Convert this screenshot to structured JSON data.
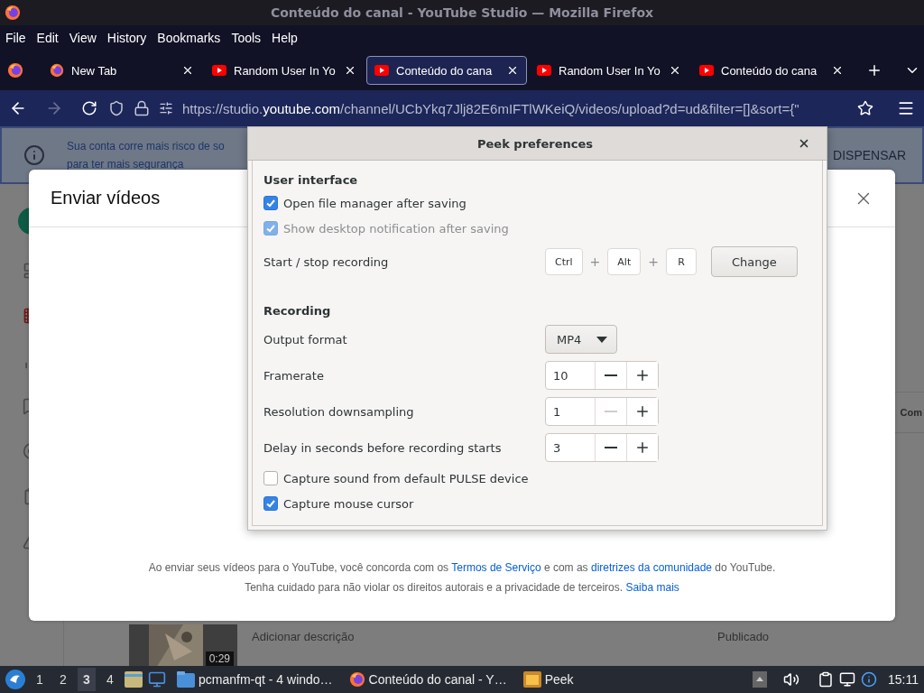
{
  "window": {
    "title": "Conteúdo do canal - YouTube Studio — Mozilla Firefox"
  },
  "menu": [
    "File",
    "Edit",
    "View",
    "History",
    "Bookmarks",
    "Tools",
    "Help"
  ],
  "tabs": [
    {
      "label": "New Tab",
      "kind": "firefox",
      "selected": false
    },
    {
      "label": "Random User In Yo",
      "kind": "youtube",
      "selected": false
    },
    {
      "label": "Conteúdo do cana",
      "kind": "youtube",
      "selected": true
    },
    {
      "label": "Random User In Yo",
      "kind": "youtube",
      "selected": false
    },
    {
      "label": "Conteúdo do cana",
      "kind": "youtube",
      "selected": false
    }
  ],
  "address_bar": {
    "prefix": "https://studio.",
    "domain": "youtube.com",
    "rest": "/channel/UCbYkq7Jlj82E6mIFTlWKeiQ/videos/upload?d=ud&filter=[]&sort={\""
  },
  "page": {
    "banner": {
      "lines": [
        "Sua conta corre mais risco de so",
        "para ter mais segurança"
      ],
      "action": "DISPENSAR"
    },
    "column_header": "Com",
    "video_row": {
      "duration": "0:29",
      "description": "Adicionar descrição",
      "visibility": "Publicado"
    }
  },
  "upload_dialog": {
    "title": "Enviar vídeos",
    "footer": [
      [
        {
          "text": "Ao enviar seus vídeos para o YouTube, você concorda com os ",
          "link": false
        },
        {
          "text": "Termos de Serviço",
          "link": true
        },
        {
          "text": " e com as ",
          "link": false
        },
        {
          "text": "diretrizes da comunidade",
          "link": true
        },
        {
          "text": " do YouTube.",
          "link": false
        }
      ],
      [
        {
          "text": "Tenha cuidado para não violar os direitos autorais e a privacidade de terceiros. ",
          "link": false
        },
        {
          "text": "Saiba mais",
          "link": true
        }
      ]
    ]
  },
  "peek_dialog": {
    "title": "Peek preferences",
    "sections": [
      {
        "heading": "User interface",
        "rows": [
          {
            "kind": "checkbox",
            "label": "Open file manager after saving",
            "checked": true,
            "disabled": false
          },
          {
            "kind": "checkbox",
            "label": "Show desktop notification after saving",
            "checked": true,
            "disabled": true
          },
          {
            "kind": "shortcut",
            "label": "Start / stop recording",
            "keys": [
              "Ctrl",
              "Alt",
              "R"
            ],
            "joiners": [
              "+",
              "+"
            ],
            "button": "Change"
          }
        ]
      },
      {
        "heading": "Recording",
        "rows": [
          {
            "kind": "dropdown",
            "label": "Output format",
            "value": "MP4"
          },
          {
            "kind": "spin",
            "label": "Framerate",
            "value": "10",
            "minus_disabled": false
          },
          {
            "kind": "spin",
            "label": "Resolution downsampling",
            "value": "1",
            "minus_disabled": true
          },
          {
            "kind": "spin",
            "label": "Delay in seconds before recording starts",
            "value": "3",
            "minus_disabled": false
          },
          {
            "kind": "checkbox",
            "label": "Capture sound from default PULSE device",
            "checked": false,
            "disabled": false
          },
          {
            "kind": "checkbox",
            "label": "Capture mouse cursor",
            "checked": true,
            "disabled": false
          }
        ]
      }
    ]
  },
  "taskbar": {
    "workspaces": [
      {
        "label": "1",
        "selected": false
      },
      {
        "label": "2",
        "selected": false
      },
      {
        "label": "3",
        "selected": true
      },
      {
        "label": "4",
        "selected": false
      }
    ],
    "windows": [
      {
        "label": "pcmanfm-qt - 4 windo…",
        "kind": "folder"
      },
      {
        "label": "Conteúdo do canal - Y…",
        "kind": "firefox"
      },
      {
        "label": "Peek",
        "kind": "peek"
      }
    ],
    "clock": "15:11"
  }
}
